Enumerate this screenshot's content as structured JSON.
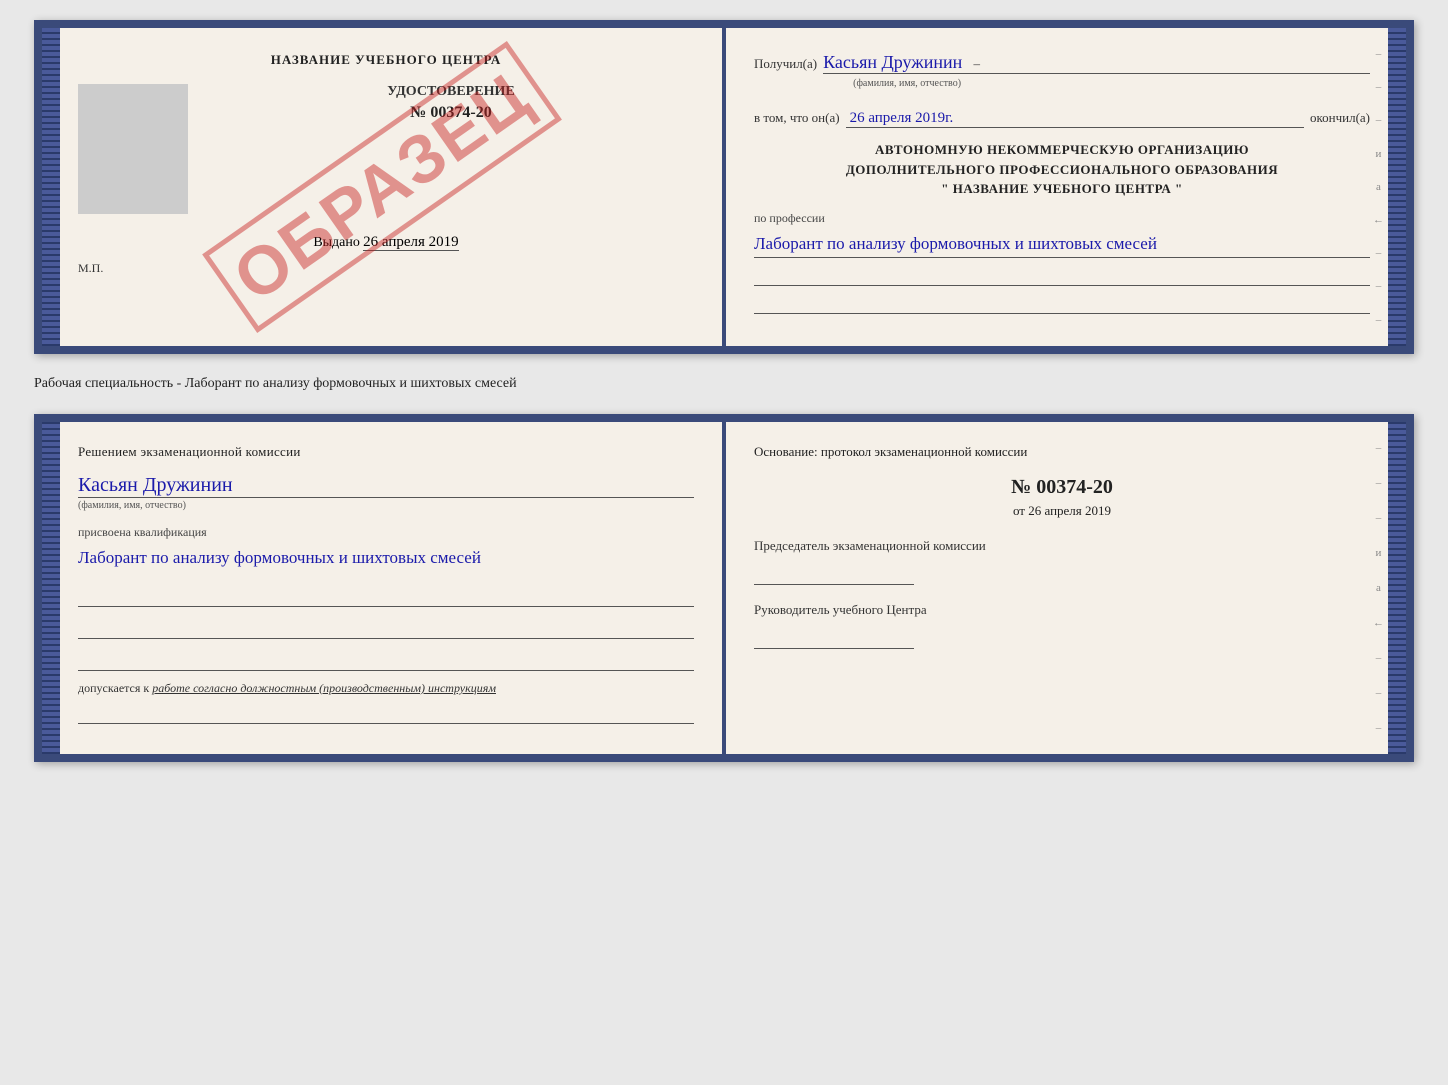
{
  "top_booklet": {
    "left": {
      "title": "НАЗВАНИЕ УЧЕБНОГО ЦЕНТРА",
      "cert_type": "УДОСТОВЕРЕНИЕ",
      "cert_number": "№ 00374-20",
      "issued_label": "Выдано",
      "issued_date": "26 апреля 2019",
      "mp_label": "М.П.",
      "obrazec": "ОБРАЗЕЦ"
    },
    "right": {
      "received_label": "Получил(а)",
      "received_name": "Касьян Дружинин",
      "fio_note": "(фамилия, имя, отчество)",
      "dash": "–",
      "in_that_label": "в том, что он(а)",
      "completed_date": "26 апреля 2019г.",
      "completed_label": "окончил(а)",
      "org_line1": "АВТОНОМНУЮ НЕКОММЕРЧЕСКУЮ ОРГАНИЗАЦИЮ",
      "org_line2": "ДОПОЛНИТЕЛЬНОГО ПРОФЕССИОНАЛЬНОГО ОБРАЗОВАНИЯ",
      "org_line3": "\" НАЗВАНИЕ УЧЕБНОГО ЦЕНТРА \"",
      "profession_label": "по профессии",
      "profession_handwritten": "Лаборант по анализу формовочных и шихтовых смесей"
    }
  },
  "middle": {
    "text": "Рабочая специальность - Лаборант по анализу формовочных и шихтовых смесей"
  },
  "bottom_booklet": {
    "left": {
      "decision_title": "Решением экзаменационной комиссии",
      "name_handwritten": "Касьян Дружинин",
      "fio_note": "(фамилия, имя, отчество)",
      "qualification_label": "присвоена квалификация",
      "qualification_handwritten": "Лаборант по анализу формовочных и шихтовых смесей",
      "допуск_label": "допускается к",
      "допуск_text": "работе согласно должностным (производственным) инструкциям"
    },
    "right": {
      "osnov_title": "Основание: протокол экзаменационной комиссии",
      "proto_number": "№ 00374-20",
      "proto_date_prefix": "от",
      "proto_date": "26 апреля 2019",
      "chair_label": "Председатель экзаменационной комиссии",
      "rukov_label": "Руководитель учебного Центра"
    }
  },
  "colors": {
    "border": "#3a4a7a",
    "handwritten": "#1a1aaa",
    "stamp_red": "rgba(200,30,30,0.45)",
    "text": "#222",
    "label": "#444"
  }
}
